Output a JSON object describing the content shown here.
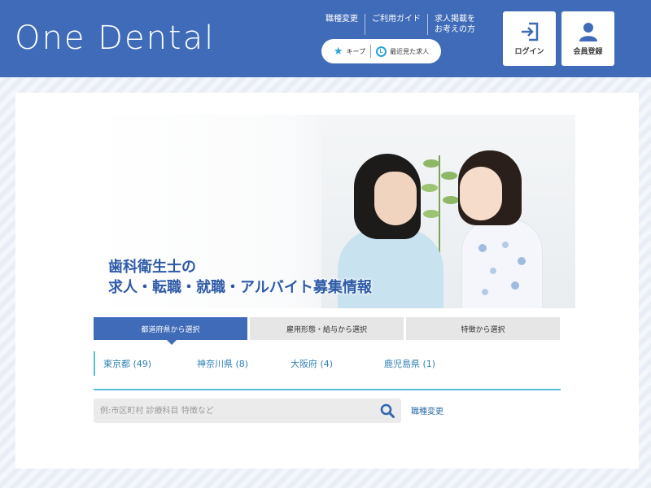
{
  "header": {
    "logo": "One Dental",
    "links": [
      "職種変更",
      "ご利用ガイド",
      "求人掲載を\nお考えの方"
    ],
    "keep_label": "キープ",
    "recent_label": "最近見た求人",
    "login_label": "ログイン",
    "register_label": "会員登録"
  },
  "hero": {
    "title_line1": "歯科衛生士の",
    "title_line2": "求人・転職・就職・アルバイト募集情報"
  },
  "tabs": [
    {
      "label": "都道府県から選択",
      "active": true
    },
    {
      "label": "雇用形態・給与から選択",
      "active": false
    },
    {
      "label": "特徴から選択",
      "active": false
    }
  ],
  "prefectures": [
    "東京都 (49)",
    "神奈川県 (8)",
    "大阪府 (4)",
    "鹿児島県 (1)"
  ],
  "search": {
    "placeholder": "例:市区町村 診療科目 特徴など",
    "job_change": "職種変更"
  },
  "colors": {
    "brand": "#3f6bb8",
    "accent": "#29a3d9",
    "link": "#2f7fb5"
  }
}
